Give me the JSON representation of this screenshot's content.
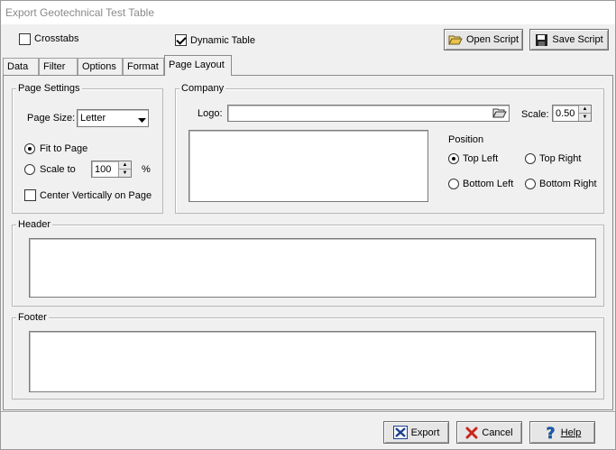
{
  "window": {
    "title": "Export Geotechnical Test Table"
  },
  "top": {
    "crosstabs_label": "Crosstabs",
    "crosstabs_checked": false,
    "dynamic_table_label": "Dynamic Table",
    "dynamic_table_checked": true,
    "open_script_label": "Open Script",
    "save_script_label": "Save Script"
  },
  "tabs": [
    {
      "label": "Data"
    },
    {
      "label": "Filter"
    },
    {
      "label": "Options"
    },
    {
      "label": "Format"
    },
    {
      "label": "Page Layout",
      "active": true
    }
  ],
  "page_settings": {
    "group_label": "Page Settings",
    "page_size_label": "Page Size:",
    "page_size_value": "Letter",
    "fit_to_page_label": "Fit to Page",
    "fit_to_page_selected": true,
    "scale_to_label": "Scale to",
    "scale_value": "100",
    "percent_label": "%",
    "center_vertically_label": "Center Vertically on Page",
    "center_vertically_checked": false
  },
  "company": {
    "group_label": "Company",
    "logo_label": "Logo:",
    "logo_value": "",
    "scale_label": "Scale:",
    "scale_value": "0.50",
    "position_label": "Position",
    "positions": {
      "top_left": "Top Left",
      "top_right": "Top Right",
      "bottom_left": "Bottom Left",
      "bottom_right": "Bottom Right"
    },
    "selected_position": "Top Left"
  },
  "header": {
    "group_label": "Header",
    "value": ""
  },
  "footer": {
    "group_label": "Footer",
    "value": ""
  },
  "bottom": {
    "export_label": "Export",
    "cancel_label": "Cancel",
    "help_label": "Help"
  },
  "colors": {
    "window_bg": "#f0f0f0",
    "title_text": "#8a8a8a",
    "export_icon": "#1a3f8f",
    "cancel_icon": "#c8261d",
    "help_icon": "#1f5fb5",
    "folder_icon": "#e8c34a"
  }
}
